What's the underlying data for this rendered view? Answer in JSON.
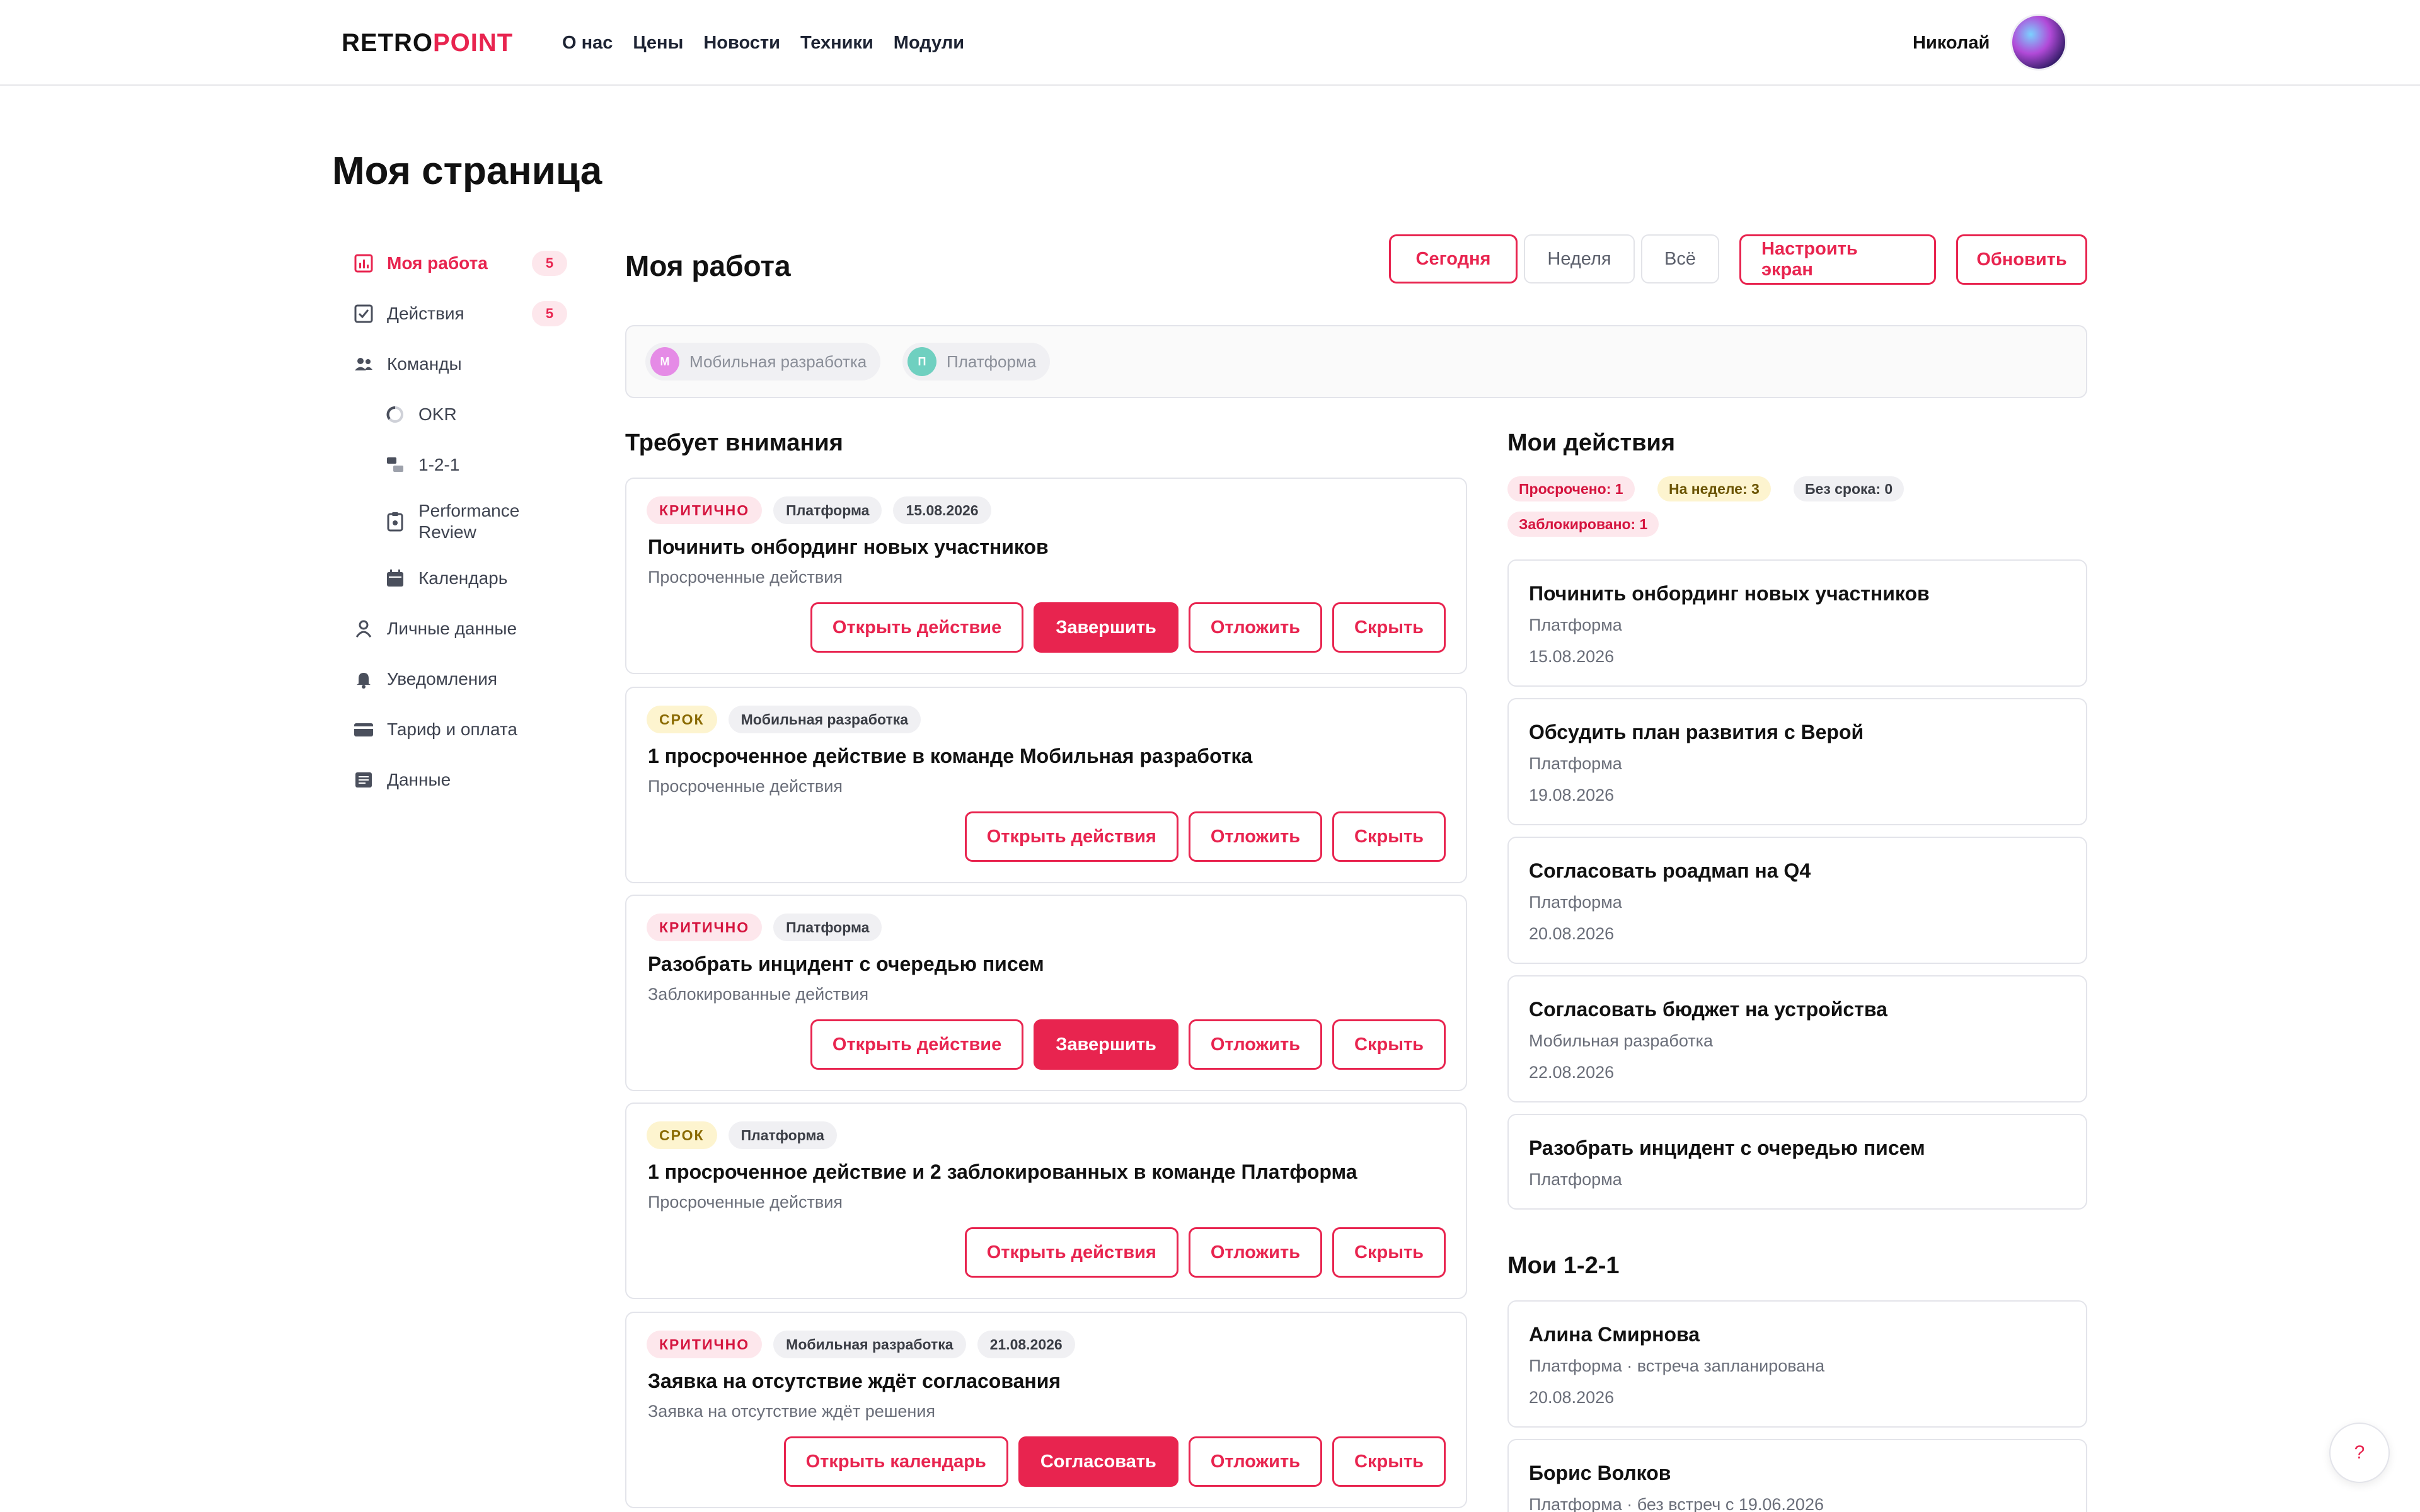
{
  "brand": {
    "logo_part1": "RETRO",
    "logo_part2": "POINT",
    "accent": "#e8244f"
  },
  "nav": [
    "О нас",
    "Цены",
    "Новости",
    "Техники",
    "Модули"
  ],
  "user": {
    "name": "Николай"
  },
  "page_title": "Моя страница",
  "sidebar": {
    "items": [
      {
        "label": "Моя работа",
        "count": "5",
        "icon": "bar-chart-icon"
      },
      {
        "label": "Действия",
        "count": "5",
        "icon": "checkbox-icon"
      },
      {
        "label": "Команды",
        "icon": "team-icon"
      },
      {
        "label": "OKR",
        "icon": "progress-ring-icon"
      },
      {
        "label": "1-2-1",
        "icon": "chat-icon"
      },
      {
        "label": "Performance Review",
        "icon": "clipboard-icon"
      },
      {
        "label": "Календарь",
        "icon": "calendar-icon"
      },
      {
        "label": "Личные данные",
        "icon": "person-icon"
      },
      {
        "label": "Уведомления",
        "icon": "bell-icon"
      },
      {
        "label": "Тариф и оплата",
        "icon": "card-icon"
      },
      {
        "label": "Данные",
        "icon": "document-icon"
      }
    ]
  },
  "main": {
    "title": "Моя работа",
    "periods": [
      "Сегодня",
      "Неделя",
      "Всё"
    ],
    "configure_label": "Настроить экран",
    "refresh_label": "Обновить",
    "teams": [
      {
        "initial": "М",
        "name": "Мобильная разработка",
        "color": "#e58be6"
      },
      {
        "initial": "П",
        "name": "Платформа",
        "color": "#6fd0c0"
      }
    ]
  },
  "attention": {
    "title": "Требует внимания",
    "cards": [
      {
        "tags": [
          "КРИТИЧНО",
          "Платформа",
          "15.08.2026"
        ],
        "title": "Починить онбординг новых участников",
        "sub": "Просроченные действия",
        "actions": [
          "Открыть действие",
          "Завершить",
          "Отложить",
          "Скрыть"
        ]
      },
      {
        "tags": [
          "СРОК",
          "Мобильная разработка"
        ],
        "title": "1 просроченное действие в команде Мобильная разработка",
        "sub": "Просроченные действия",
        "actions": [
          "Открыть действия",
          "Отложить",
          "Скрыть"
        ]
      },
      {
        "tags": [
          "КРИТИЧНО",
          "Платформа"
        ],
        "title": "Разобрать инцидент с очередью писем",
        "sub": "Заблокированные действия",
        "actions": [
          "Открыть действие",
          "Завершить",
          "Отложить",
          "Скрыть"
        ]
      },
      {
        "tags": [
          "СРОК",
          "Платформа"
        ],
        "title": "1 просроченное действие и 2 заблокированных в команде Платформа",
        "sub": "Просроченные действия",
        "actions": [
          "Открыть действия",
          "Отложить",
          "Скрыть"
        ]
      },
      {
        "tags": [
          "КРИТИЧНО",
          "Мобильная разработка",
          "21.08.2026"
        ],
        "title": "Заявка на отсутствие ждёт согласования",
        "sub": "Заявка на отсутствие ждёт решения",
        "actions": [
          "Открыть календарь",
          "Согласовать",
          "Отложить",
          "Скрыть"
        ]
      }
    ]
  },
  "my_actions": {
    "title": "Мои действия",
    "pills": [
      "Просрочено: 1",
      "На неделе: 3",
      "Без срока: 0",
      "Заблокировано: 1"
    ],
    "items": [
      {
        "title": "Починить онбординг новых участников",
        "team": "Платформа",
        "date": "15.08.2026"
      },
      {
        "title": "Обсудить план развития с Верой",
        "team": "Платформа",
        "date": "19.08.2026"
      },
      {
        "title": "Согласовать роадмап на Q4",
        "team": "Платформа",
        "date": "20.08.2026"
      },
      {
        "title": "Согласовать бюджет на устройства",
        "team": "Мобильная разработка",
        "date": "22.08.2026"
      },
      {
        "title": "Разобрать инцидент с очередью писем",
        "team": "Платформа"
      }
    ]
  },
  "one_on_one": {
    "title": "Мои 1-2-1",
    "items": [
      {
        "name": "Алина Смирнова",
        "sub": "Платформа · встреча запланирована",
        "date": "20.08.2026"
      },
      {
        "name": "Борис Волков",
        "sub": "Платформа · без встреч с 19.06.2026"
      }
    ]
  },
  "help_label": "?"
}
